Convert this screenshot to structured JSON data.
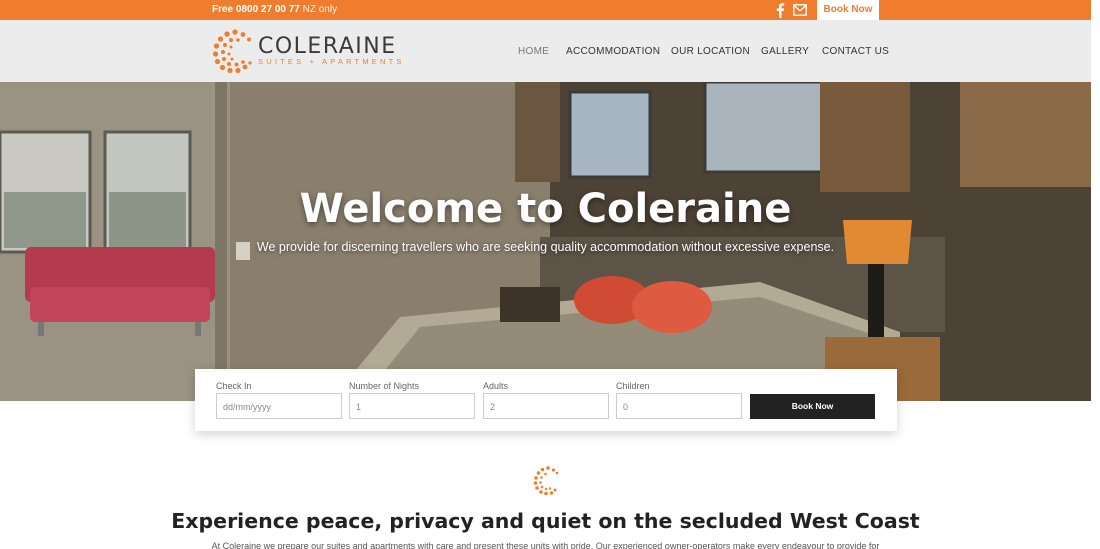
{
  "topbar": {
    "phone_label": "Free 0800 27 00 77",
    "phone_note": "NZ only",
    "book_label": "Book Now",
    "icons": [
      "facebook-icon",
      "mail-icon"
    ]
  },
  "header": {
    "logo_name": "COLERAINE",
    "logo_sub": "SUITES  +  APARTMENTS",
    "nav": [
      "HOME",
      "ACCOMMODATION",
      "OUR LOCATION",
      "GALLERY",
      "CONTACT US"
    ]
  },
  "hero": {
    "title": "Welcome to Coleraine",
    "subtitle": "We provide for discerning travellers who are seeking quality accommodation without excessive expense."
  },
  "booking": {
    "checkin_label": "Check In",
    "checkin_placeholder": "dd/mm/yyyy",
    "nights_label": "Number of Nights",
    "nights_value": "1",
    "adults_label": "Adults",
    "adults_value": "2",
    "children_label": "Children",
    "children_value": "0",
    "submit_label": "Book Now"
  },
  "intro": {
    "title": "Experience peace, privacy and quiet on the secluded West Coast",
    "text": "At Coleraine we prepare our suites and apartments with care and present these units with pride. Our experienced owner-operators make every endeavour to provide for"
  },
  "colors": {
    "accent": "#ef7d2d",
    "dark": "#222222",
    "header_bg": "#ececec"
  }
}
